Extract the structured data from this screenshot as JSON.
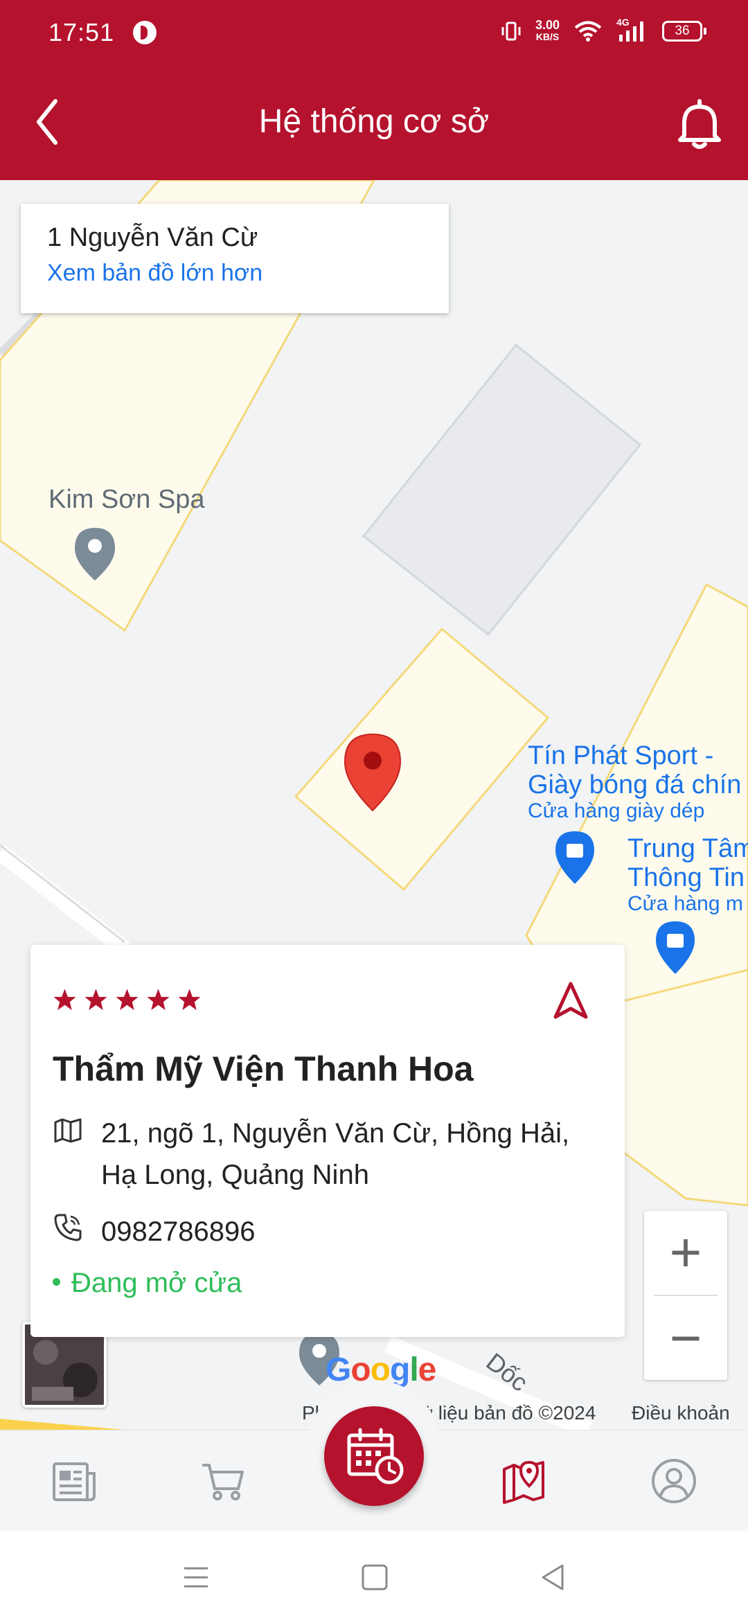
{
  "status_bar": {
    "time": "17:51",
    "speed_value": "3.00",
    "speed_unit": "KB/S",
    "network": "4G",
    "battery": "36"
  },
  "header": {
    "title": "Hệ thống cơ sở",
    "icons": [
      "chevron-left-icon",
      "bell-icon"
    ]
  },
  "map": {
    "place_card": {
      "title": "1 Nguyễn Văn Cừ",
      "link": "Xem bản đồ lớn hơn"
    },
    "pois": {
      "spa": "Kim Sơn Spa",
      "sport_line1": "Tín Phát Sport -",
      "sport_line2": "Giày bóng đá chín",
      "sport_category": "Cửa hàng giày dép",
      "center_line1": "Trung Tâm",
      "center_line2": "Thông Tin",
      "center_category": "Cửa hàng m",
      "road": "Dốc"
    },
    "google_logo": "Google",
    "footer": {
      "shortcuts": "Phím",
      "data": "Dữ liệu bản đồ ©2024",
      "terms": "Điều khoản"
    },
    "zoom_in": "+",
    "zoom_out": "−",
    "colors": {
      "building_fill": "#fefbed",
      "building_stroke": "#f5d87a",
      "pin": "#ea4335",
      "poi_blue": "#1a73e8"
    }
  },
  "info_card": {
    "rating": 5,
    "name": "Thẩm Mỹ Viện Thanh Hoa",
    "address": "21, ngõ 1, Nguyễn Văn Cừ, Hồng Hải, Hạ Long, Quảng Ninh",
    "phone": "0982786896",
    "status": "Đang mở cửa",
    "colors": {
      "star": "#b5122d",
      "open": "#2ebd59"
    }
  },
  "bottom_nav": {
    "items": [
      "news-icon",
      "cart-icon",
      "calendar-clock-icon",
      "map-pin-icon",
      "user-icon"
    ],
    "active": "map-pin-icon",
    "accent": "#b5122d"
  }
}
